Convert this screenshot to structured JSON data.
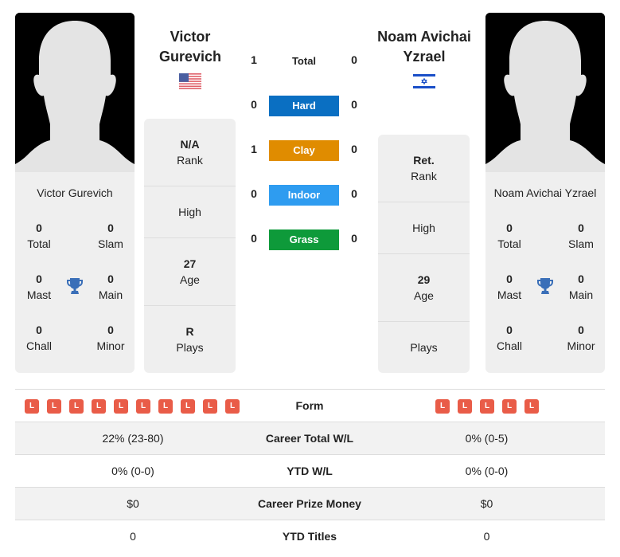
{
  "player_left": {
    "name": "Victor Gurevich",
    "name_line1": "Victor",
    "name_line2": "Gurevich",
    "country_flag": "usa-flag",
    "titles": {
      "total": {
        "value": "0",
        "label": "Total"
      },
      "slam": {
        "value": "0",
        "label": "Slam"
      },
      "mast": {
        "value": "0",
        "label": "Mast"
      },
      "main": {
        "value": "0",
        "label": "Main"
      },
      "chall": {
        "value": "0",
        "label": "Chall"
      },
      "minor": {
        "value": "0",
        "label": "Minor"
      }
    },
    "info": {
      "rank": {
        "value": "N/A",
        "label": "Rank"
      },
      "high": {
        "value": "",
        "label": "High"
      },
      "age": {
        "value": "27",
        "label": "Age"
      },
      "plays": {
        "value": "R",
        "label": "Plays"
      }
    }
  },
  "player_right": {
    "name": "Noam Avichai Yzrael",
    "name_line1": "Noam Avichai",
    "name_line2": "Yzrael",
    "country_flag": "israel-flag",
    "titles": {
      "total": {
        "value": "0",
        "label": "Total"
      },
      "slam": {
        "value": "0",
        "label": "Slam"
      },
      "mast": {
        "value": "0",
        "label": "Mast"
      },
      "main": {
        "value": "0",
        "label": "Main"
      },
      "chall": {
        "value": "0",
        "label": "Chall"
      },
      "minor": {
        "value": "0",
        "label": "Minor"
      }
    },
    "info": {
      "rank": {
        "value": "Ret.",
        "label": "Rank"
      },
      "high": {
        "value": "",
        "label": "High"
      },
      "age": {
        "value": "29",
        "label": "Age"
      },
      "plays": {
        "value": "",
        "label": "Plays"
      }
    }
  },
  "h2h": [
    {
      "label": "Total",
      "left": "1",
      "right": "0",
      "color": ""
    },
    {
      "label": "Hard",
      "left": "0",
      "right": "0",
      "color": "#0a6fc2"
    },
    {
      "label": "Clay",
      "left": "1",
      "right": "0",
      "color": "#e08c00"
    },
    {
      "label": "Indoor",
      "left": "0",
      "right": "0",
      "color": "#2e9cf0"
    },
    {
      "label": "Grass",
      "left": "0",
      "right": "0",
      "color": "#0e9a3a"
    }
  ],
  "comparison": {
    "form": {
      "label": "Form",
      "left": [
        "L",
        "L",
        "L",
        "L",
        "L",
        "L",
        "L",
        "L",
        "L",
        "L"
      ],
      "right": [
        "L",
        "L",
        "L",
        "L",
        "L"
      ]
    },
    "rows": [
      {
        "label": "Career Total W/L",
        "left": "22% (23-80)",
        "right": "0% (0-5)"
      },
      {
        "label": "YTD W/L",
        "left": "0% (0-0)",
        "right": "0% (0-0)"
      },
      {
        "label": "Career Prize Money",
        "left": "$0",
        "right": "$0"
      },
      {
        "label": "YTD Titles",
        "left": "0",
        "right": "0"
      }
    ]
  },
  "colors": {
    "loss_badge": "#e95c48",
    "trophy": "#3a6fb8"
  }
}
